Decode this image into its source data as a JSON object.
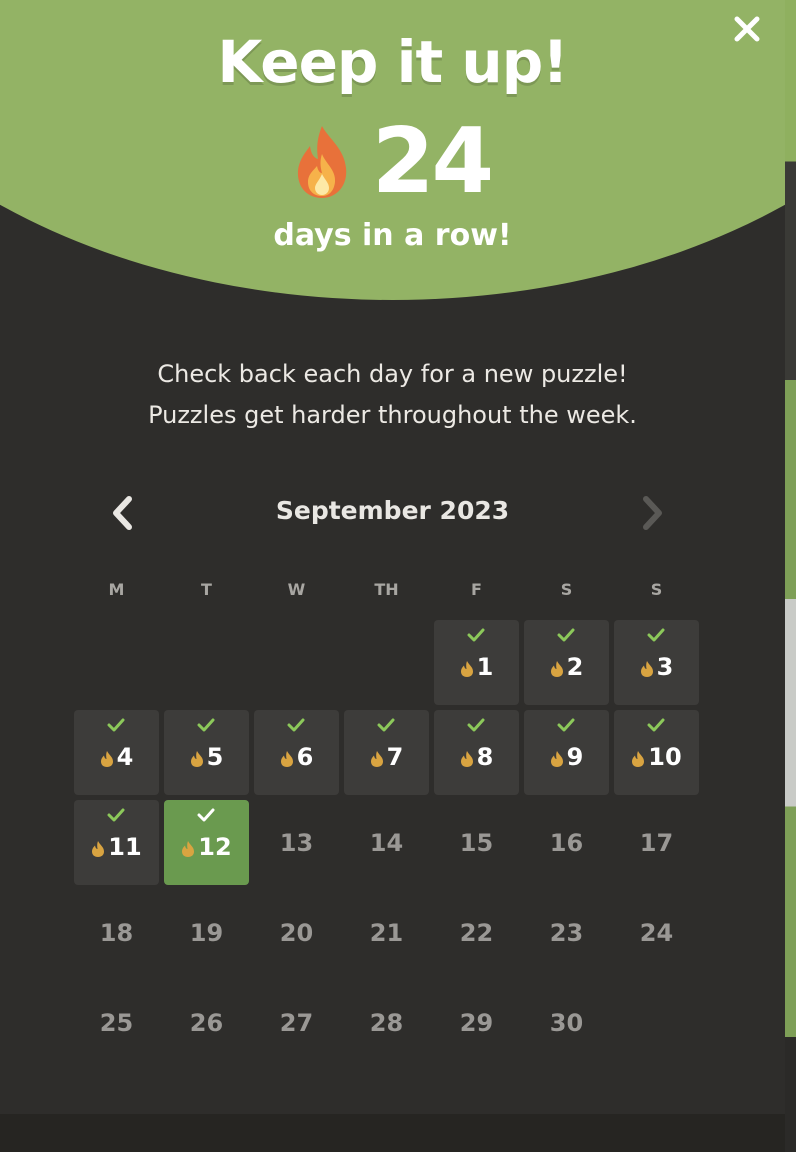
{
  "modal": {
    "title": "Keep it up!",
    "streak_count": "24",
    "streak_unit": "days in a row!",
    "message_line1": "Check back each day for a new puzzle!",
    "message_line2": "Puzzles get harder throughout the week.",
    "close_icon": "close-icon"
  },
  "calendar": {
    "month_label": "September 2023",
    "weekdays": [
      "M",
      "T",
      "W",
      "TH",
      "F",
      "S",
      "S"
    ],
    "leading_blanks": 4,
    "days": [
      {
        "n": "1",
        "state": "done"
      },
      {
        "n": "2",
        "state": "done"
      },
      {
        "n": "3",
        "state": "done"
      },
      {
        "n": "4",
        "state": "done"
      },
      {
        "n": "5",
        "state": "done"
      },
      {
        "n": "6",
        "state": "done"
      },
      {
        "n": "7",
        "state": "done"
      },
      {
        "n": "8",
        "state": "done"
      },
      {
        "n": "9",
        "state": "done"
      },
      {
        "n": "10",
        "state": "done"
      },
      {
        "n": "11",
        "state": "done"
      },
      {
        "n": "12",
        "state": "today"
      },
      {
        "n": "13",
        "state": "future"
      },
      {
        "n": "14",
        "state": "future"
      },
      {
        "n": "15",
        "state": "future"
      },
      {
        "n": "16",
        "state": "future"
      },
      {
        "n": "17",
        "state": "future"
      },
      {
        "n": "18",
        "state": "future"
      },
      {
        "n": "19",
        "state": "future"
      },
      {
        "n": "20",
        "state": "future"
      },
      {
        "n": "21",
        "state": "future"
      },
      {
        "n": "22",
        "state": "future"
      },
      {
        "n": "23",
        "state": "future"
      },
      {
        "n": "24",
        "state": "future"
      },
      {
        "n": "25",
        "state": "future"
      },
      {
        "n": "26",
        "state": "future"
      },
      {
        "n": "27",
        "state": "future"
      },
      {
        "n": "28",
        "state": "future"
      },
      {
        "n": "29",
        "state": "future"
      },
      {
        "n": "30",
        "state": "future"
      }
    ]
  },
  "colors": {
    "hero_green": "#93b365",
    "background": "#2e2d2b",
    "done_cell": "#3d3c3a",
    "today_cell": "#6a9a4f",
    "check_green": "#8cc85a",
    "small_flame": "#d9a441"
  }
}
